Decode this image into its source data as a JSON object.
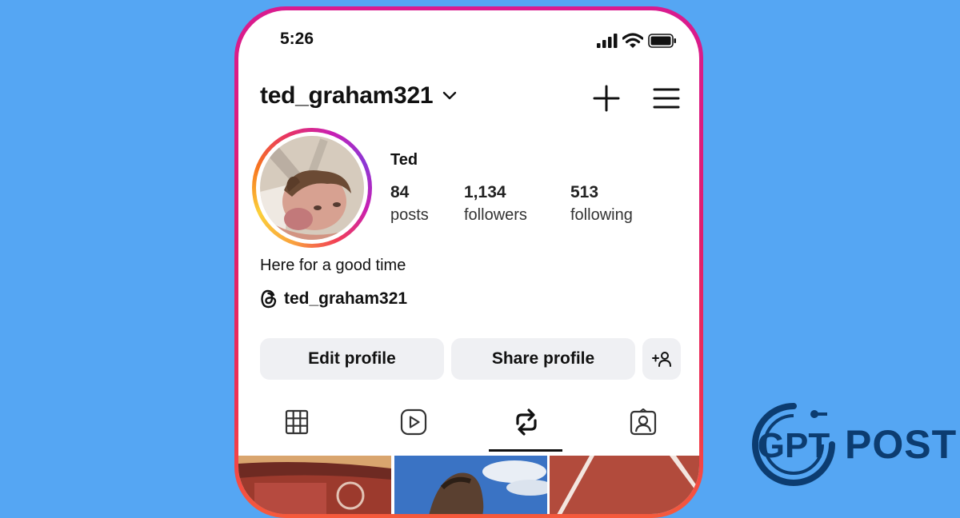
{
  "status": {
    "time": "5:26"
  },
  "profile": {
    "username": "ted_graham321",
    "display_name": "Ted",
    "bio": "Here for a good time",
    "threads_handle": "ted_graham321",
    "stats": [
      {
        "value": "84",
        "label": "posts"
      },
      {
        "value": "1,134",
        "label": "followers"
      },
      {
        "value": "513",
        "label": "following"
      }
    ]
  },
  "buttons": {
    "edit": "Edit profile",
    "share": "Share profile"
  },
  "tabs": [
    {
      "icon": "grid-icon"
    },
    {
      "icon": "reels-icon"
    },
    {
      "icon": "reposts-icon",
      "active": true
    },
    {
      "icon": "tagged-icon"
    }
  ],
  "icons": {
    "username_dropdown": "chevron-down-icon",
    "create": "plus-icon",
    "menu": "hamburger-menu-icon",
    "threads": "threads-icon",
    "add_person": "add-person-icon"
  },
  "colors": {
    "background": "#55a6f3",
    "phone_border": "#e01e6d",
    "button_bg": "#eff0f3",
    "logo": "#0c3c70"
  },
  "watermark": {
    "line1": "GPT",
    "line2": "POST"
  }
}
